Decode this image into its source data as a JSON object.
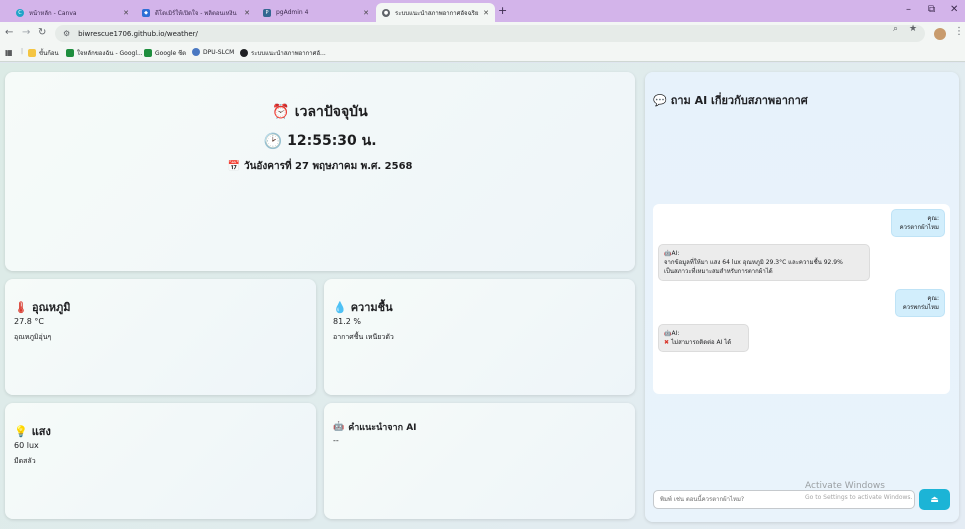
{
  "browser": {
    "tabs": [
      {
        "title": "หน้าหลัก - Canva",
        "favicon": "canva-icon",
        "color": "#20a4c8"
      },
      {
        "title": "ดีโดเมิร์ให้เปิดใจ - พลิตอนเหงิน",
        "favicon": "shield-icon",
        "color": "#2d6fd6"
      },
      {
        "title": "pgAdmin 4",
        "favicon": "pgadmin-icon",
        "color": "#336791"
      },
      {
        "title": "ระบบแนะนำสภาพอากาศอัจฉริยะ",
        "favicon": "globe-icon",
        "color": "#5f6368"
      }
    ],
    "window_controls": {
      "minimize": "–",
      "maximize": "⧉",
      "close": "✕"
    },
    "new_tab": "+",
    "url": "biwrescue1706.github.io/weather/",
    "bookmarks": [
      {
        "label": "",
        "icon": "apps-grid-icon"
      },
      {
        "label": "ขั้นก้อน",
        "icon": "folder-icon",
        "color": "#f4c542"
      },
      {
        "label": "ใจหลักของฉัน - Googl...",
        "icon": "sheets-icon",
        "color": "#1e8e3e"
      },
      {
        "label": "Google ชีต",
        "icon": "sheets-icon",
        "color": "#1e8e3e"
      },
      {
        "label": "DPU-SLCM",
        "icon": "dpu-icon",
        "color": "#4a78c2"
      },
      {
        "label": "ระบบแนะนำสภาพอากาศอั...",
        "icon": "globe-icon",
        "color": "#202124"
      }
    ]
  },
  "clock": {
    "title": "เวลาปัจจุบัน",
    "time": "12:55:30 น.",
    "date": "วันอังคารที่ 27 พฤษภาคม พ.ศ. 2568"
  },
  "sensors": {
    "temperature": {
      "title": "อุณหภูมิ",
      "value": "27.8 °C",
      "desc": "อุณหภูมิอุ่นๆ"
    },
    "humidity": {
      "title": "ความชื้น",
      "value": "81.2 %",
      "desc": "อากาศชื้น เหนียวตัว"
    },
    "light": {
      "title": "แสง",
      "value": "60 lux",
      "desc": "มืดสลัว"
    },
    "ai_advice": {
      "title": "คำแนะนำจาก AI",
      "value": "--"
    }
  },
  "ai_chat": {
    "title": "ถาม AI เกี่ยวกับสภาพอากาศ",
    "messages": [
      {
        "role": "user",
        "who": "คุณ:",
        "text": "ควรตากผ้าไหม"
      },
      {
        "role": "ai",
        "who": "AI:",
        "text1": "จากข้อมูลที่ให้มา แสง 64 lux อุณหภูมิ 29.3°C และความชื้น 92.9%",
        "text2": "เป็นสภาวะที่เหมาะสมสำหรับการตากผ้าได้"
      },
      {
        "role": "user",
        "who": "คุณ:",
        "text": "ควรพกร่มไหม"
      },
      {
        "role": "ai",
        "who": "AI:",
        "text": "ไม่สามารถติดต่อ AI ได้"
      }
    ],
    "input_placeholder": "พิมพ์ เช่น ตอนนี้ควรตากผ้าไหม?",
    "send_icon": "send-icon"
  },
  "watermark": {
    "line1": "Activate Windows",
    "line2": "Go to Settings to activate Windows."
  }
}
